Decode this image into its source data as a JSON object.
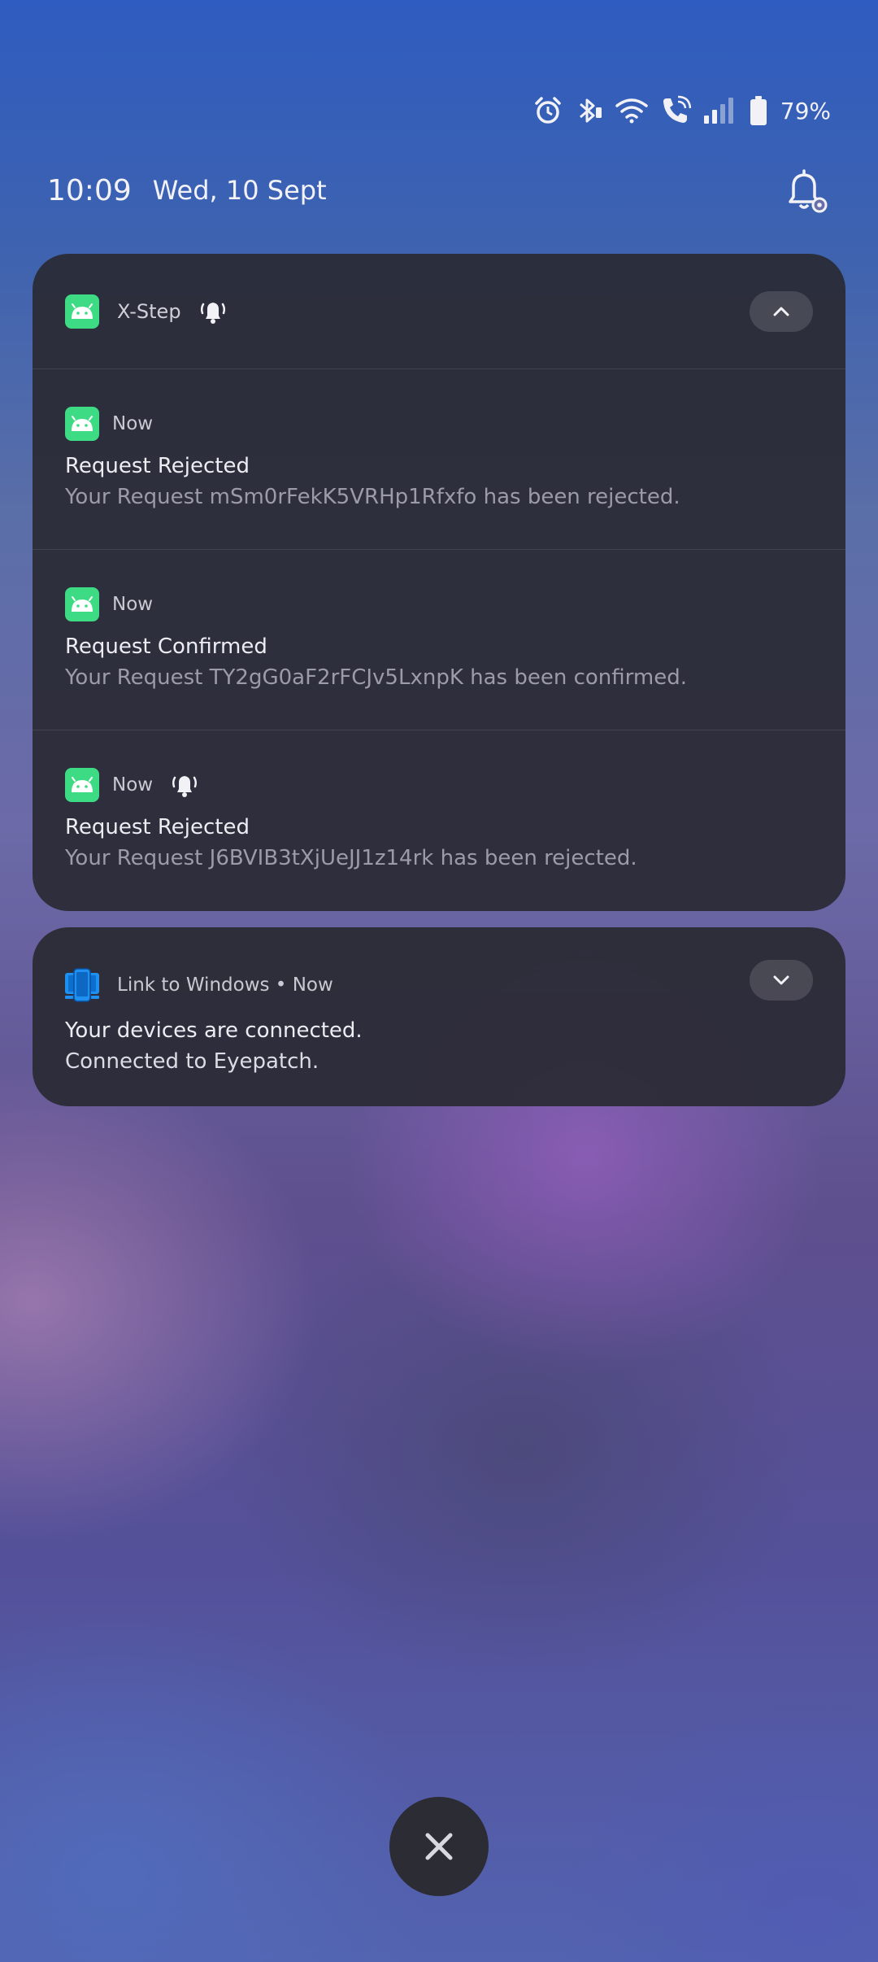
{
  "status": {
    "battery_percent": "79%",
    "icons": [
      "alarm-icon",
      "bluetooth-icon",
      "wifi-icon",
      "wifi-calling-icon",
      "signal-icon",
      "battery-icon"
    ]
  },
  "header": {
    "time": "10:09",
    "date": "Wed, 10 Sept"
  },
  "group": {
    "app_name": "X-Step",
    "notifications": [
      {
        "time": "Now",
        "title": "Request Rejected",
        "text": "Your Request mSm0rFekK5VRHp1Rfxfo has been rejected.",
        "alerting": false
      },
      {
        "time": "Now",
        "title": "Request Confirmed",
        "text": "Your Request TY2gG0aF2rFCJv5LxnpK has been confirmed.",
        "alerting": false
      },
      {
        "time": "Now",
        "title": "Request Rejected",
        "text": "Your Request J6BVIB3tXjUeJJ1z14rk has been rejected.",
        "alerting": true
      }
    ]
  },
  "link": {
    "app_name": "Link to Windows",
    "separator": "•",
    "time": "Now",
    "line1": "Your devices are connected.",
    "line2": "Connected to Eyepatch."
  },
  "colors": {
    "android_green": "#3ddc84",
    "link_blue": "#1f8ff0",
    "card_bg": "#2a2a34"
  }
}
